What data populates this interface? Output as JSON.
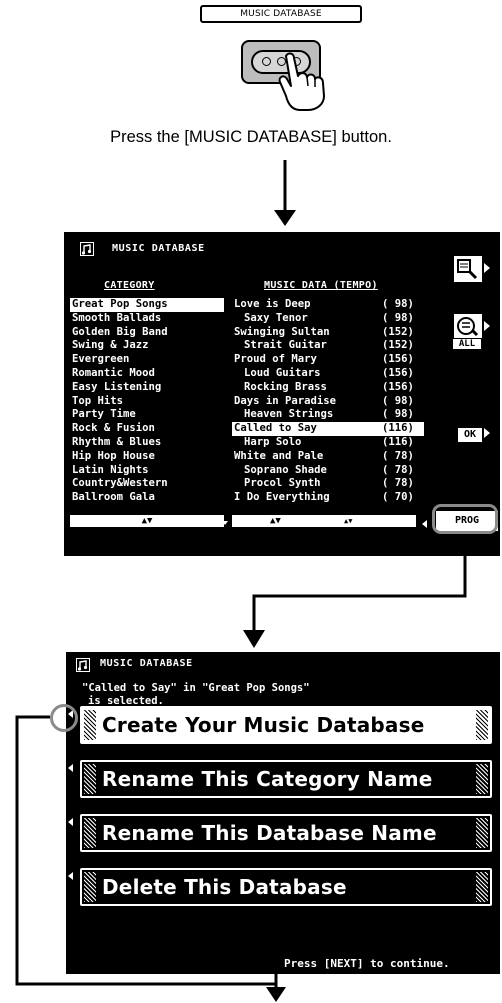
{
  "panel": {
    "button_label": "MUSIC DATABASE",
    "instruction": "Press the [MUSIC DATABASE] button."
  },
  "screen1": {
    "title": "MUSIC DATABASE",
    "category_header": "CATEGORY",
    "db_header": "MUSIC DATA (TEMPO)",
    "categories": [
      "Great Pop Songs",
      "Smooth Ballads",
      "Golden Big Band",
      "Swing & Jazz",
      "Evergreen",
      "Romantic Mood",
      "Easy Listening",
      "Top Hits",
      "Party Time",
      "Rock & Fusion",
      "Rhythm & Blues",
      "Hip Hop House",
      "Latin Nights",
      "Country&Western",
      "Ballroom Gala"
    ],
    "selected_category": 0,
    "database": [
      {
        "name": "Love is Deep",
        "tempo": "( 98)",
        "sub": false
      },
      {
        "name": "Saxy Tenor",
        "tempo": "( 98)",
        "sub": true
      },
      {
        "name": "Swinging Sultan",
        "tempo": "(152)",
        "sub": false
      },
      {
        "name": "Strait Guitar",
        "tempo": "(152)",
        "sub": true
      },
      {
        "name": "Proud of Mary",
        "tempo": "(156)",
        "sub": false
      },
      {
        "name": "Loud Guitars",
        "tempo": "(156)",
        "sub": true
      },
      {
        "name": "Rocking Brass",
        "tempo": "(156)",
        "sub": true
      },
      {
        "name": "Days in Paradise",
        "tempo": "( 98)",
        "sub": false
      },
      {
        "name": "Heaven Strings",
        "tempo": "( 98)",
        "sub": true
      },
      {
        "name": "Called to Say",
        "tempo": "(116)",
        "sub": false
      },
      {
        "name": "Harp Solo",
        "tempo": "(116)",
        "sub": true
      },
      {
        "name": "White and Pale",
        "tempo": "( 78)",
        "sub": false
      },
      {
        "name": "Soprano Shade",
        "tempo": "( 78)",
        "sub": true
      },
      {
        "name": "Procol Synth",
        "tempo": "( 78)",
        "sub": true
      },
      {
        "name": "I Do Everything",
        "tempo": "( 70)",
        "sub": false
      }
    ],
    "selected_db": 9,
    "scroll_arrows": "▲▼",
    "scroll_arrows_small": "▲▼",
    "all_label": "ALL",
    "ok_label": "OK",
    "prog_label": "PROG"
  },
  "screen2": {
    "title": "MUSIC DATABASE",
    "message_line1": "\"Called to Say\" in \"Great Pop Songs\"",
    "message_line2": "is selected.",
    "menu": [
      "Create Your Music Database",
      "Rename This Category Name",
      "Rename This Database Name",
      "Delete This Database"
    ],
    "selected_menu": 0,
    "footer": "Press [NEXT] to continue."
  }
}
